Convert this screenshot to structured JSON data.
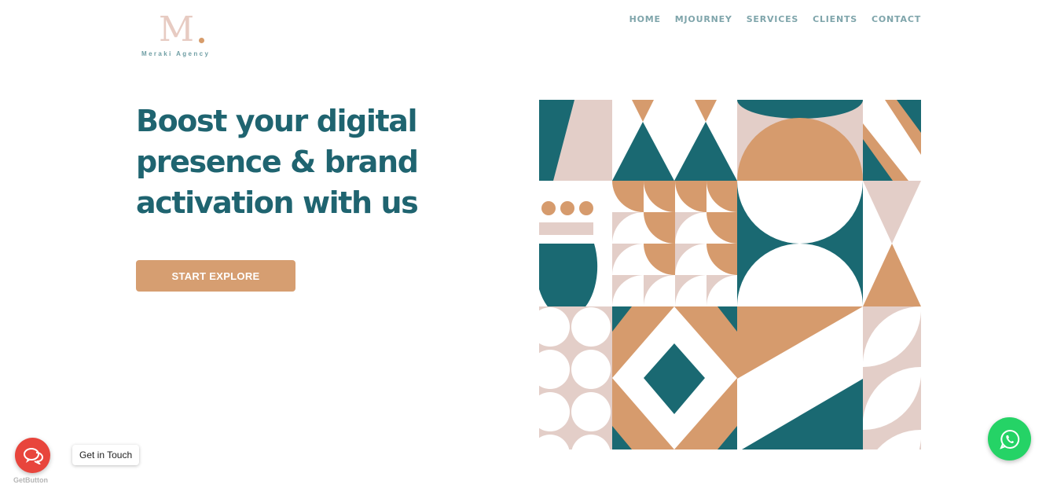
{
  "logo": {
    "mark": "M",
    "name": "Meraki Agency"
  },
  "nav": {
    "items": [
      {
        "label": "HOME"
      },
      {
        "label": "MJOURNEY"
      },
      {
        "label": "SERVICES"
      },
      {
        "label": "CLIENTS"
      },
      {
        "label": "CONTACT"
      }
    ]
  },
  "hero": {
    "title_lines": [
      "Boost your digital",
      "presence & brand",
      "activation with us"
    ],
    "cta_label": "START EXPLORE"
  },
  "widgets": {
    "chat_tooltip": "Get in Touch",
    "chat_brand": "GetButton",
    "chat_icon": "chat-bubbles-icon",
    "whatsapp_icon": "whatsapp-icon"
  },
  "colors": {
    "teal": "#1a6972",
    "peach": "#d69b6d",
    "blush": "#e3cec8",
    "nav": "#7fa5ab",
    "heading": "#1f6470",
    "chat_red": "#e8453c",
    "whatsapp_green": "#25d366"
  }
}
